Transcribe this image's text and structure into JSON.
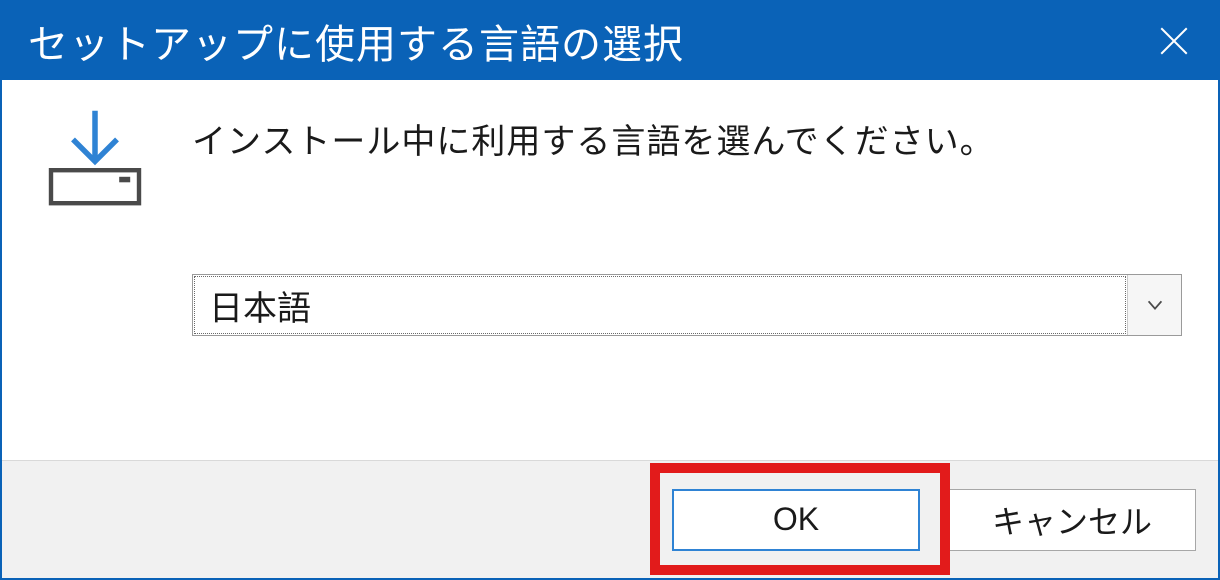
{
  "window": {
    "title": "セットアップに使用する言語の選択"
  },
  "body": {
    "instruction": "インストール中に利用する言語を選んでください。"
  },
  "dropdown": {
    "selected": "日本語"
  },
  "buttons": {
    "ok": "OK",
    "cancel": "キャンセル"
  }
}
